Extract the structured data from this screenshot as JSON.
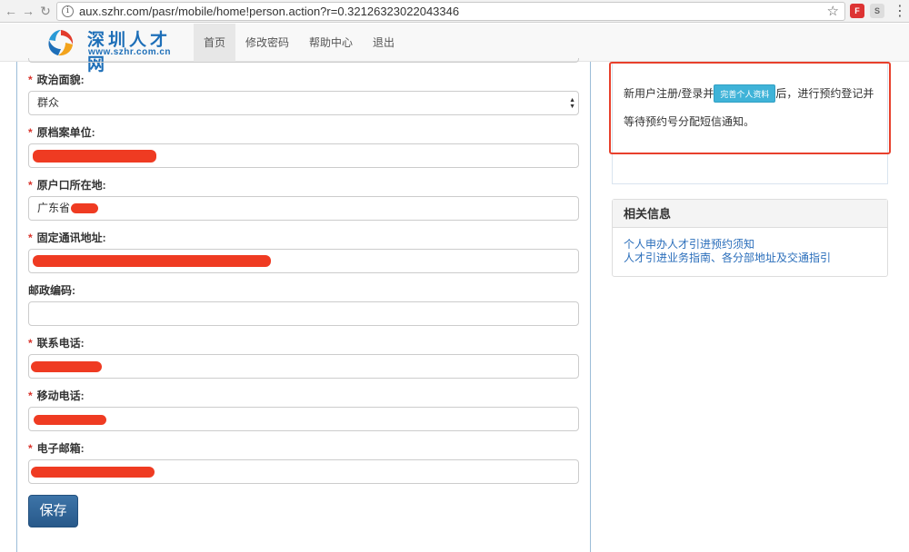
{
  "browser": {
    "url": "aux.szhr.com/pasr/mobile/home!person.action?r=0.32126323022043346",
    "ext1": "F",
    "ext2": "S"
  },
  "site": {
    "logo_cn": "深圳人才网",
    "logo_en": "www.szhr.com.cn",
    "nav": [
      "首页",
      "修改密码",
      "帮助中心",
      "退出"
    ]
  },
  "form": {
    "fields": [
      {
        "label": "政治面貌:",
        "required": true,
        "value": "群众"
      },
      {
        "label": "原档案单位:",
        "required": true,
        "value": ""
      },
      {
        "label": "原户口所在地:",
        "required": true,
        "value": "广东省"
      },
      {
        "label": "固定通讯地址:",
        "required": true,
        "value": ""
      },
      {
        "label": "邮政编码:",
        "required": false,
        "value": ""
      },
      {
        "label": "联系电话:",
        "required": true,
        "value": ""
      },
      {
        "label": "移动电话:",
        "required": true,
        "value": ""
      },
      {
        "label": "电子邮箱:",
        "required": true,
        "value": ""
      }
    ],
    "required_mark": "*",
    "save_label": "保存"
  },
  "notice": {
    "text_before": "新用户注册/登录并",
    "button": "完善个人资料",
    "text_after": "后，进行预约登记并",
    "line2": "等待预约号分配短信通知。"
  },
  "related": {
    "title": "相关信息",
    "links": [
      "个人申办人才引进预约须知",
      "人才引进业务指南、各分部地址及交通指引"
    ]
  },
  "colors": {
    "required": "#d9332b",
    "link": "#2a6ebb",
    "highlight": "#e8402c",
    "button_blue": "#28598a"
  }
}
